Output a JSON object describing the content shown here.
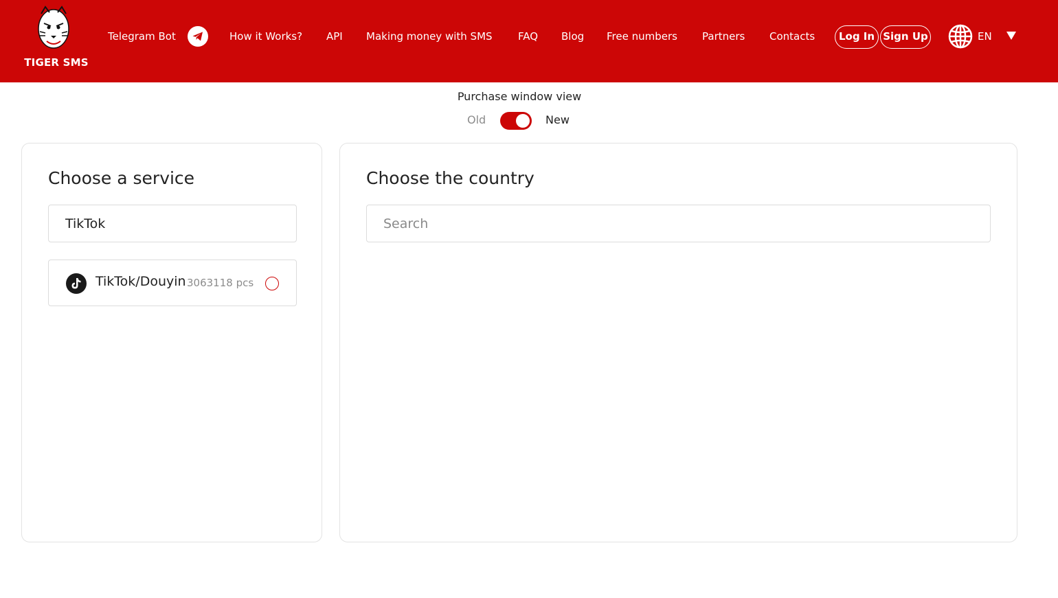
{
  "brand": {
    "logo_text": "TIGER SMS"
  },
  "nav": {
    "telegram_bot": "Telegram Bot",
    "how_it_works": "How it Works?",
    "api": "API",
    "making_money": "Making money with SMS",
    "faq": "FAQ",
    "blog": "Blog",
    "free_numbers": "Free numbers",
    "partners": "Partners",
    "contacts": "Contacts",
    "login": "Log In",
    "signup": "Sign Up",
    "language": "EN"
  },
  "purchase_view": {
    "title": "Purchase window view",
    "option_old": "Old",
    "option_new": "New",
    "selected": "New"
  },
  "service_panel": {
    "title": "Choose a service",
    "search_value": "TikTok",
    "items": [
      {
        "name": "TikTok/Douyin",
        "count": "3063118 pcs",
        "icon": "tiktok-icon",
        "selected": false
      }
    ]
  },
  "country_panel": {
    "title": "Choose the country",
    "search_placeholder": "Search"
  },
  "colors": {
    "brand_red": "#cc0606"
  }
}
